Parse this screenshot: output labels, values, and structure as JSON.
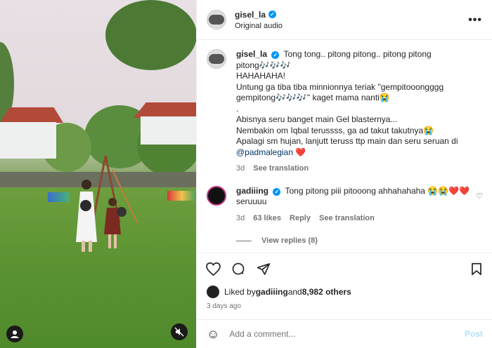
{
  "header": {
    "username": "gisel_la",
    "subtitle": "Original audio",
    "more_icon": "more-dots-icon"
  },
  "caption": {
    "username": "gisel_la",
    "text_lines": [
      "Tong tong.. pitong pitong.. pitong pitong",
      "pitong🎶🎶🎶",
      "HAHAHAHA!",
      "Untung ga tiba tiba minnionnya teriak \"gempitooongggg",
      "gempitong🎶🎶🎶\" kaget mama nanti😭",
      ".",
      "Abisnya seru banget main Gel blasternya...",
      "Nembakin om Iqbal terussss, ga ad takut takutnya😭",
      "Apalagi sm hujan, lanjutt teruss ttp main dan seru seruan di"
    ],
    "mention": "@padmalegian",
    "mention_suffix": " ❤️",
    "time": "3d",
    "see_translation": "See translation"
  },
  "comment": {
    "username": "gadiiing",
    "text": "Tong pitong piii pitooong ahhahahaha 😭😭❤️❤️",
    "text_line2": "seruuuu",
    "time": "3d",
    "likes": "63 likes",
    "reply": "Reply",
    "see_translation": "See translation",
    "view_replies": "View replies (8)"
  },
  "actions": {
    "like_icon": "heart-icon",
    "comment_icon": "comment-icon",
    "share_icon": "share-icon",
    "save_icon": "bookmark-icon"
  },
  "likes": {
    "prefix": "Liked by ",
    "user": "gadiiing",
    "middle": " and ",
    "others": "8,982 others"
  },
  "date": "3 days ago",
  "add_comment": {
    "placeholder": "Add a comment...",
    "post": "Post"
  }
}
